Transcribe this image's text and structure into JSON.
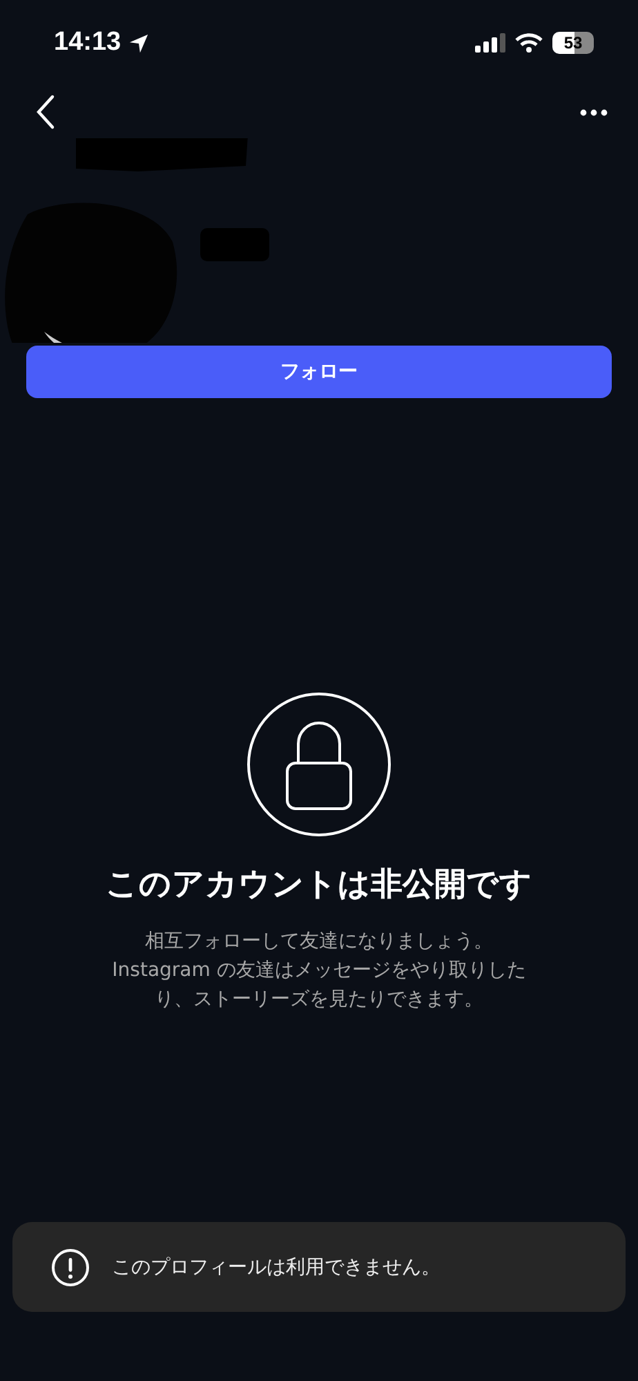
{
  "status_bar": {
    "time": "14:13",
    "battery": "53"
  },
  "profile": {
    "follow_button": "フォロー"
  },
  "private_notice": {
    "title": "このアカウントは非公開です",
    "description_lines": [
      "相互フォローして友達になりましょう。",
      "Instagram の友達はメッセージをやり取りした",
      "り、ストーリーズを見たりできます。"
    ]
  },
  "toast": {
    "message": "このプロフィールは利用できません。"
  }
}
